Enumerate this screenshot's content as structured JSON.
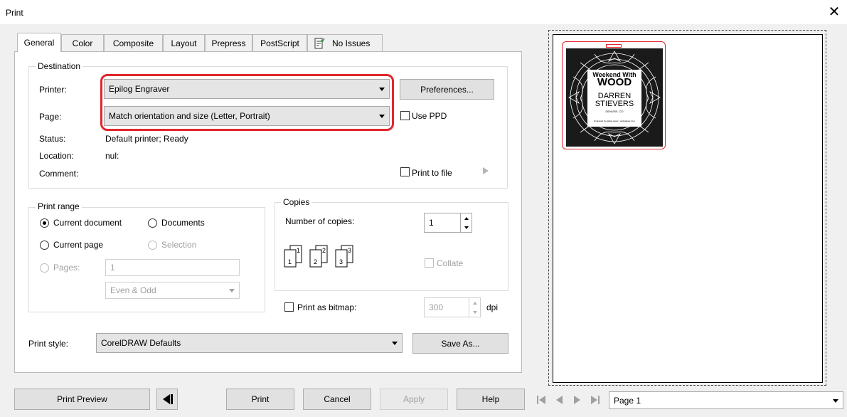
{
  "window": {
    "title": "Print",
    "close_glyph": "✕"
  },
  "tabs": [
    {
      "label": "General"
    },
    {
      "label": "Color"
    },
    {
      "label": "Composite"
    },
    {
      "label": "Layout"
    },
    {
      "label": "Prepress"
    },
    {
      "label": "PostScript"
    },
    {
      "label": "No Issues"
    }
  ],
  "destination": {
    "title": "Destination",
    "printer_label": "Printer:",
    "printer_value": "Epilog Engraver",
    "preferences_button": "Preferences...",
    "page_label": "Page:",
    "page_value": "Match orientation and size (Letter, Portrait)",
    "use_ppd_label": "Use PPD",
    "status_label": "Status:",
    "status_value": "Default printer; Ready",
    "location_label": "Location:",
    "location_value": "nul:",
    "comment_label": "Comment:",
    "print_to_file_label": "Print to file"
  },
  "print_range": {
    "title": "Print range",
    "current_document": "Current document",
    "documents": "Documents",
    "current_page": "Current page",
    "selection": "Selection",
    "pages_label": "Pages:",
    "pages_value": "1",
    "even_odd_value": "Even & Odd"
  },
  "copies": {
    "title": "Copies",
    "number_label": "Number of copies:",
    "number_value": "1",
    "collate_label": "Collate",
    "collate_icon_numbers": [
      "1",
      "1",
      "2",
      "2",
      "3",
      "3"
    ]
  },
  "bitmap": {
    "label": "Print as bitmap:",
    "dpi_value": "300",
    "dpi_unit": "dpi"
  },
  "print_style": {
    "label": "Print style:",
    "value": "CorelDRAW Defaults",
    "save_as_button": "Save As..."
  },
  "bottom_buttons": {
    "print_preview": "Print Preview",
    "print": "Print",
    "cancel": "Cancel",
    "apply": "Apply",
    "help": "Help"
  },
  "preview": {
    "page_select_value": "Page 1",
    "artwork": {
      "line1": "Weekend With",
      "line2": "WOOD",
      "line3": "DARREN",
      "line4": "STIEVERS",
      "line5": "DENVER, CO",
      "line6": "Engraved by Epilog Laser | epiloglaser.com"
    }
  },
  "colors": {
    "highlight": "#e2262d",
    "check_green": "#2e9b3a"
  }
}
